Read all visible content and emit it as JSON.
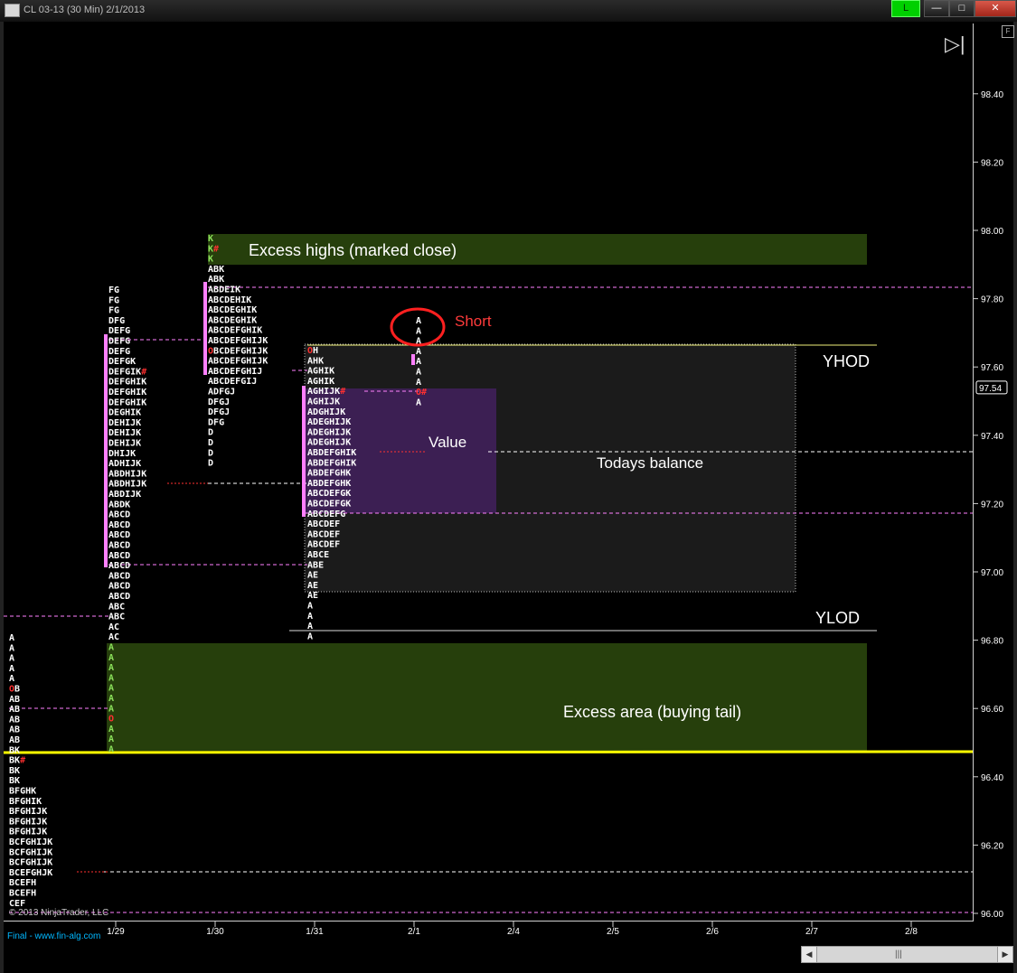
{
  "window": {
    "title": "CL 03-13 (30 Min)  2/1/2013",
    "indicator": "L",
    "min_glyph": "—",
    "max_glyph": "□",
    "close_glyph": "✕",
    "f_button": "F",
    "play_glyph": "▷|"
  },
  "colors": {
    "background": "#000000",
    "letters": "#ffffff",
    "green_box": "#263f0c",
    "value_box": "#3c1f53",
    "balance_box": "#1b1b1b",
    "pink": "#ff80ff",
    "yellow": "#ffff00",
    "red": "#ff3030"
  },
  "price_axis": {
    "labels": [
      "98.40",
      "98.20",
      "98.00",
      "97.80",
      "97.60",
      "97.40",
      "97.20",
      "97.00",
      "96.80",
      "96.60",
      "96.40",
      "96.20",
      "96.00"
    ],
    "current_price": "97.54"
  },
  "date_axis": {
    "labels": [
      "1/29",
      "1/30",
      "1/31",
      "2/1",
      "2/4",
      "2/5",
      "2/6",
      "2/7",
      "2/8"
    ]
  },
  "annotations": {
    "excess_highs": "Excess highs (marked close)",
    "short": "Short",
    "yhod": "YHOD",
    "value": "Value",
    "todays_balance": "Todays balance",
    "ylod": "YLOD",
    "excess_area": "Excess area (buying tail)"
  },
  "profiles": {
    "p1": {
      "rows": [
        "A",
        "A",
        "A",
        "A",
        "A",
        "OB",
        "AB",
        "AB",
        "AB",
        "AB",
        "AB",
        "BK",
        "BK#",
        "BK",
        "BK",
        "BFGHK",
        "BFGHIK",
        "BFGHIJK",
        "BFGHIJK",
        "BFGHIJK",
        "BCFGHIJK",
        "BCFGHIJK",
        "BCFGHIJK",
        "BCEFGHJK",
        "BCEFH",
        "BCEFH",
        "CEF"
      ]
    },
    "p2": {
      "rows": [
        "FG",
        "FG",
        "FG",
        "DFG",
        "DEFG",
        "DEFG",
        "DEFG",
        "DEFGK",
        "DEFGIK#",
        "DEFGHIK",
        "DEFGHIK",
        "DEFGHIK",
        "DEGHIK",
        "DEHIJK",
        "DEHIJK",
        "DEHIJK",
        "DHIJK",
        "ADHIJK",
        "ABDHIJK",
        "ABDHIJK",
        "ABDIJK",
        "ABDK",
        "ABCD",
        "ABCD",
        "ABCD",
        "ABCD",
        "ABCD",
        "ABCD",
        "ABCD",
        "ABCD",
        "ABCD",
        "ABC",
        "ABC",
        "AC",
        "AC",
        "A",
        "A",
        "A",
        "A",
        "A",
        "A",
        "A",
        "O",
        "A",
        "A",
        "A"
      ]
    },
    "p3": {
      "rows": [
        "K",
        "K#",
        "K",
        "ABK",
        "ABK",
        "ABDEIK",
        "ABCDEHIK",
        "ABCDEGHIK",
        "ABCDEGHIK",
        "ABCDEFGHIK",
        "ABCDEFGHIJK",
        "OBCDEFGHIJK",
        "ABCDEFGHIJK",
        "ABCDEFGHIJ",
        "ABCDEFGIJ",
        "ADFGJ",
        "DFGJ",
        "DFGJ",
        "DFG",
        "D",
        "D",
        "D",
        "D"
      ]
    },
    "p4": {
      "rows": [
        "OH",
        "AHK",
        "AGHIK",
        "AGHIK",
        "AGHIJK#",
        "AGHIJK",
        "ADGHIJK",
        "ADEGHIJK",
        "ADEGHIJK",
        "ADEGHIJK",
        "ABDEFGHIK",
        "ABDEFGHIK",
        "ABDEFGHK",
        "ABDEFGHK",
        "ABCDEFGK",
        "ABCDEFGK",
        "ABCDEFG",
        "ABCDEF",
        "ABCDEF",
        "ABCDEF",
        "ABCE",
        "ABE",
        "AE",
        "AE",
        "AE",
        "A",
        "A",
        "A",
        "A"
      ]
    },
    "p5": {
      "rows": [
        "A",
        "A",
        "A",
        "A",
        "A",
        "A",
        "A",
        "O#",
        "A"
      ]
    }
  },
  "footer": {
    "copyright": "© 2013 NinjaTrader, LLC",
    "status": "Final - www.fin-alg.com"
  }
}
